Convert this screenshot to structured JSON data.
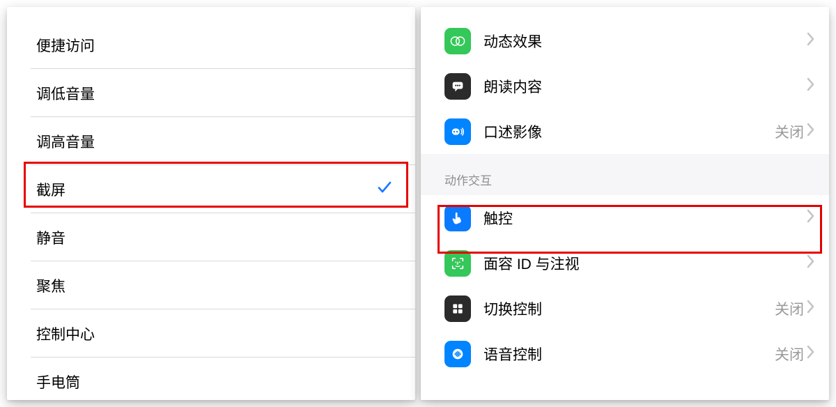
{
  "left_panel": {
    "items": [
      {
        "label": "便捷访问",
        "selected": false
      },
      {
        "label": "调低音量",
        "selected": false
      },
      {
        "label": "调高音量",
        "selected": false
      },
      {
        "label": "截屏",
        "selected": true
      },
      {
        "label": "静音",
        "selected": false
      },
      {
        "label": "聚焦",
        "selected": false
      },
      {
        "label": "控制中心",
        "selected": false
      },
      {
        "label": "手电筒",
        "selected": false
      }
    ],
    "highlighted_index": 3
  },
  "right_panel": {
    "group1": [
      {
        "icon": "motion-icon",
        "icon_color": "#34c759",
        "label": "动态效果",
        "status": ""
      },
      {
        "icon": "speech-bubble-icon",
        "icon_color": "#2b2b2b",
        "label": "朗读内容",
        "status": ""
      },
      {
        "icon": "audio-description-icon",
        "icon_color": "#0084ff",
        "label": "口述影像",
        "status": "关闭"
      }
    ],
    "section_header": "动作交互",
    "group2": [
      {
        "icon": "touch-icon",
        "icon_color": "#0a7aff",
        "label": "触控",
        "status": ""
      },
      {
        "icon": "faceid-icon",
        "icon_color": "#34c759",
        "label": "面容 ID 与注视",
        "status": ""
      },
      {
        "icon": "switch-control-icon",
        "icon_color": "#2b2b2b",
        "label": "切换控制",
        "status": "关闭"
      },
      {
        "icon": "voice-control-icon",
        "icon_color": "#0084ff",
        "label": "语音控制",
        "status": "关闭"
      }
    ],
    "highlighted_group2_index": 0
  }
}
